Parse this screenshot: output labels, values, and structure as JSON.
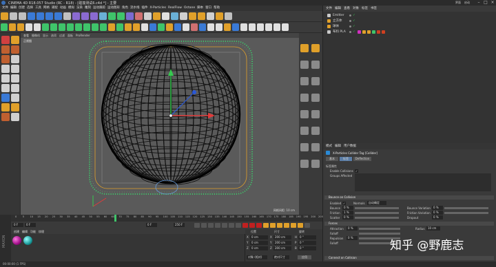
{
  "window": {
    "title": "CINEMA 4D R18.057 Studio (RC - R18) - [碰撞测试6.c4d *] - 主要",
    "layout_label": "界面",
    "layout_value": "启动"
  },
  "menubar": [
    "文件",
    "编辑",
    "创建",
    "选择",
    "工具",
    "网格",
    "捕捉",
    "动画",
    "模拟",
    "渲染",
    "雕刻",
    "运动跟踪",
    "运动图形",
    "角色",
    "流水线",
    "插件",
    "X-Particles",
    "RealFlow",
    "Octane",
    "脚本",
    "窗口",
    "帮助"
  ],
  "viewport": {
    "menu": [
      "查看",
      "摄像机",
      "显示",
      "选项",
      "过滤",
      "面板",
      "ProRender"
    ],
    "label": "正视图",
    "grid_spacing": "网格间距: 10 cm"
  },
  "object_manager": {
    "menu": [
      "文件",
      "编辑",
      "查看",
      "对象",
      "标签",
      "书签"
    ],
    "objects": [
      {
        "name": "Emitter"
      },
      {
        "name": "立方体"
      },
      {
        "name": "球体"
      },
      {
        "name": "布料 PLA"
      }
    ]
  },
  "attributes": {
    "menu": [
      "模式",
      "编辑",
      "用户数据"
    ],
    "tag_title": "X-Particles Collider Tag [Collider]",
    "tabs": [
      "基本",
      "标签",
      "Deflection"
    ],
    "section_tag_props": "标签属性",
    "enable_collisions_label": "Enable Collisions",
    "groups_affected_label": "Groups Affected",
    "bounce_section": "Bounce on Collision",
    "enabled_label": "Enabled",
    "normals_label": "Normals",
    "normals_value": "自动确定",
    "bounce_label": "Bounce",
    "bounce_value": "0 %",
    "bounce_variation_label": "Bounce Variation",
    "bounce_variation_value": "0 %",
    "friction_label": "Friction",
    "friction_value": "1 %",
    "friction_variation_label": "Friction Variation",
    "friction_variation_value": "0 %",
    "scatter_label": "Scatter",
    "scatter_value": "0 %",
    "dropout_label": "Dropout",
    "dropout_value": "0 %",
    "forces_section": "Forces",
    "attraction_label": "Attraction",
    "attraction_value": "0 %",
    "radius_label": "Radius",
    "radius_value": "10 cm",
    "falloff_label": "Falloff",
    "repulsion_label": "Repulsion",
    "repulsion_value": "0 %",
    "falloff2_label": "Falloff",
    "connect_section": "Connect on Collision",
    "connect_label": "Connect on Collision"
  },
  "timeline": {
    "ticks": [
      "0",
      "5",
      "10",
      "15",
      "20",
      "25",
      "30",
      "35",
      "40",
      "45",
      "50",
      "55",
      "60",
      "65",
      "70",
      "75",
      "80",
      "85",
      "90",
      "95",
      "100",
      "105",
      "110",
      "115",
      "120",
      "125",
      "130",
      "135",
      "140",
      "145",
      "150",
      "155",
      "160",
      "165",
      "170",
      "175",
      "180",
      "185",
      "190",
      "195",
      "200",
      "205"
    ],
    "current_frame": "0 F",
    "start_frame": "0 F",
    "end_frame": "250 F",
    "frame_right": "0 F"
  },
  "material_manager": {
    "menu": [
      "创建",
      "编辑",
      "功能",
      "纹理"
    ]
  },
  "coordinates": {
    "headers": [
      "位置",
      "尺寸",
      "旋转"
    ],
    "rows": [
      {
        "pos": "0 cm",
        "size": "200 cm",
        "rot_label": "H",
        "rot": "0 °",
        "axis": "X"
      },
      {
        "pos": "0 cm",
        "size": "200 cm",
        "rot_label": "P",
        "rot": "0 °",
        "axis": "Y"
      },
      {
        "pos": "0 cm",
        "size": "200 cm",
        "rot_label": "B",
        "rot": "0 °",
        "axis": "Z"
      }
    ],
    "mode": "对象 (相对)",
    "size_mode": "绝对尺寸",
    "apply": "应用"
  },
  "statusbar": "00:00:00 (1 FPS)",
  "watermark": "知乎 @野鹿志",
  "colors": {
    "accent": "#e0a02a",
    "particles": "#3fc46a",
    "axis_y": "#36c94f",
    "axis_x": "#e23b3b",
    "axis_z": "#2a58d6"
  }
}
